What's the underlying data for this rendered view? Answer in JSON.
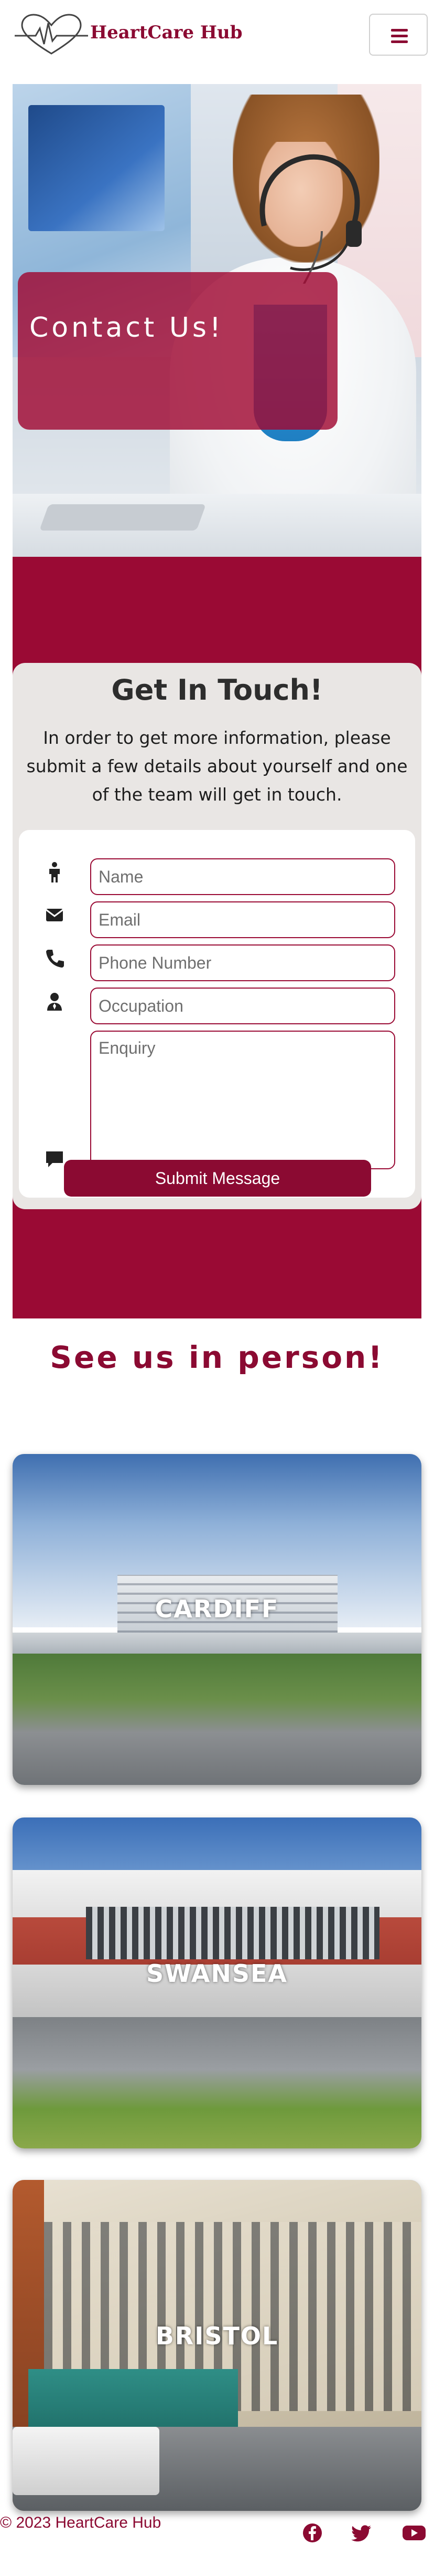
{
  "navbar": {
    "brand": "HeartCare Hub",
    "logo_icon": "heart-ecg-logo",
    "menu_icon": "hamburger-menu-icon"
  },
  "hero": {
    "title": "Contact Us!"
  },
  "contact": {
    "heading": "Get In Touch!",
    "intro": "In order to get more information, please submit a few details about yourself and one of the team will get in touch.",
    "fields": {
      "name_placeholder": "Name",
      "email_placeholder": "Email",
      "phone_placeholder": "Phone Number",
      "occupation_placeholder": "Occupation",
      "enquiry_placeholder": "Enquiry"
    },
    "submit_label": "Submit Message"
  },
  "locations": {
    "heading": "See us in person!",
    "items": [
      "CARDIFF",
      "SWANSEA",
      "BRISTOL"
    ]
  },
  "footer": {
    "copyright": "© 2023 HeartCare Hub",
    "social_icons": [
      "facebook-icon",
      "twitter-icon",
      "youtube-icon"
    ]
  },
  "colors": {
    "brand": "#8b0a32",
    "section_bg": "#9a0a34",
    "card_bg": "#e9e6e4"
  }
}
